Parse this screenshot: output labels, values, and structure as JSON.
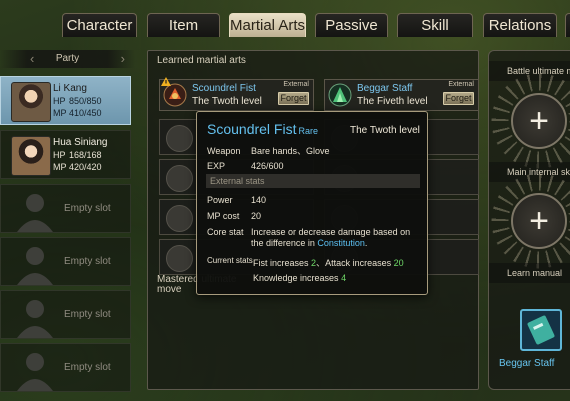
{
  "tabs": [
    "Character",
    "Item",
    "Martial Arts",
    "Passive",
    "Skill",
    "Relations"
  ],
  "party": {
    "header": "Party",
    "members": [
      {
        "name": "Li Kang",
        "hp_label": "HP",
        "hp": "850/850",
        "mp_label": "MP",
        "mp": "410/450"
      },
      {
        "name": "Hua Siniang",
        "hp_label": "HP",
        "hp": "168/168",
        "mp_label": "MP",
        "mp": "420/420"
      }
    ],
    "empty_slot_label": "Empty slot"
  },
  "learned": {
    "title": "Learned martial arts",
    "skills": [
      {
        "name": "Scoundrel Fist",
        "level": "The Twoth level",
        "tag": "External",
        "button": "Forget"
      },
      {
        "name": "Beggar Staff",
        "level": "The Fiveth level",
        "tag": "External",
        "button": "Forget"
      }
    ],
    "mastered_title": "Mastered ultimate move"
  },
  "right": {
    "battle_label": "Battle ultimate m",
    "internal_label": "Main internal sk",
    "manual_label": "Learn manual",
    "manual_name": "Beggar Staff",
    "plus": "+"
  },
  "tooltip": {
    "name": "Scoundrel Fist",
    "rarity": "Rare",
    "level": "The Twoth level",
    "weapon_label": "Weapon",
    "weapon": "Bare hands、Glove",
    "exp_label": "EXP",
    "exp": "426/600",
    "section": "External stats",
    "power_label": "Power",
    "power": "140",
    "mpcost_label": "MP cost",
    "mpcost": "20",
    "core_label": "Core stat",
    "core_pre": "Increase or decrease damage based on the difference in ",
    "core_hl": "Constitution",
    "core_post": ".",
    "current_label": "Current stats",
    "fist_text": "Fist increases ",
    "fist_val": "2",
    "sep": "、",
    "attack_text": "Attack increases ",
    "attack_val": "20",
    "knowledge_text": "Knowledge increases ",
    "knowledge_val": "4"
  }
}
